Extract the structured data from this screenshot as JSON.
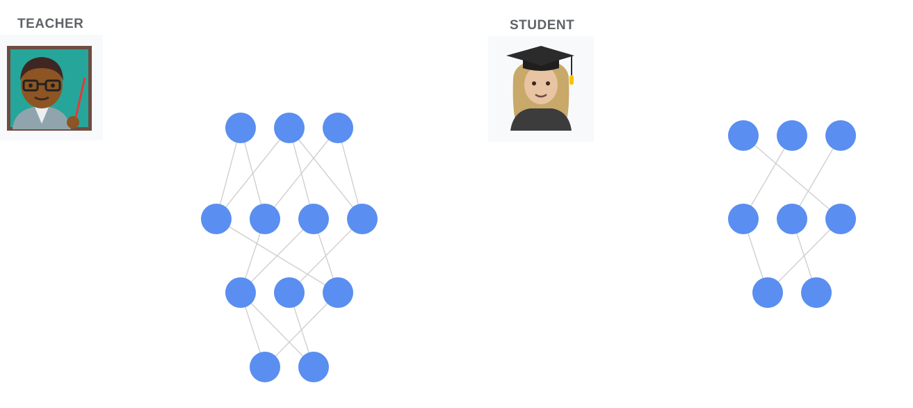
{
  "teacher": {
    "label": "TEACHER"
  },
  "student": {
    "label": "STUDENT"
  },
  "colors": {
    "node": "#5a8ef0",
    "edge": "#cfcfcf",
    "label": "#5f6368"
  }
}
